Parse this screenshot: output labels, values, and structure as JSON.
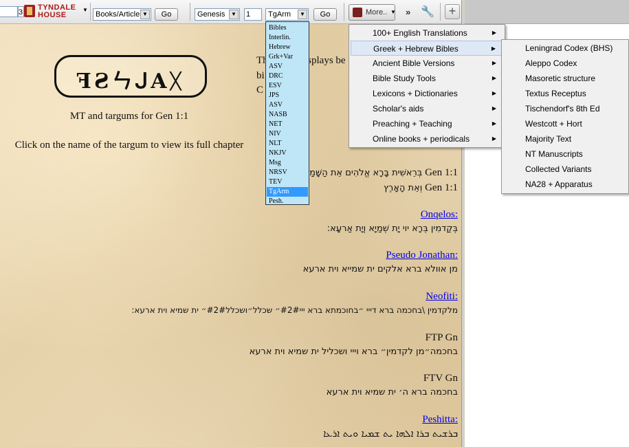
{
  "toolbar": {
    "search_value": "",
    "small_field_value": "3",
    "logo_line1": "TYNDALE",
    "logo_line2": "HOUSE",
    "books_select": "Books/Articles",
    "go1": "Go",
    "book_select": "Genesis",
    "chapter_value": "1",
    "version_select": "TgArm",
    "go2": "Go",
    "more_label": "More..",
    "chevron": "»",
    "plus": "+"
  },
  "versions_list": [
    "Bibles",
    "Interlin.",
    "Hebrew",
    "Grk+Var",
    "ASV",
    "DRC",
    "ESV",
    "JPS",
    "ASV",
    "NASB",
    "NET",
    "NIV",
    "NLT",
    "NKJV",
    "Msg",
    "NRSV",
    "TEV",
    "TgArm",
    "Pesh."
  ],
  "versions_selected_index": 17,
  "menu": {
    "items": [
      {
        "label": "100+ English Translations"
      },
      {
        "label": "Greek + Hebrew Bibles"
      },
      {
        "label": "Ancient Bible Versions"
      },
      {
        "label": "Bible Study Tools"
      },
      {
        "label": "Lexicons + Dictionaries"
      },
      {
        "label": "Scholar's aids"
      },
      {
        "label": "Preaching + Teaching"
      },
      {
        "label": "Online books + periodicals"
      }
    ],
    "highlighted_index": 1,
    "submenu": [
      "Leningrad Codex (BHS)",
      "Aleppo Codex",
      "Masoretic structure",
      "Textus Receptus",
      "Tischendorf's 8th Ed",
      "Westcott + Hort",
      "Majority Text",
      "NT Manuscripts",
      "Collected Variants",
      "NA28 + Apparatus"
    ]
  },
  "content": {
    "cartouche_text": "ꟻƧㄣᒍAᚷ",
    "caption": "MT and targums for Gen 1:1",
    "instruction": "Click on the name of the targum to view its full chapter",
    "intro_line1": "This page displays be",
    "intro_line2": "bi               such as",
    "intro_line3": "C               loaded int",
    "mt_ref": "Gen 1:1",
    "mt_line1": "בְּרֵאשִׁית בָּרָא אֱלֹהִים אֵת הַשָּׁמַ",
    "mt_line2": "וְאֵת הָאָרֶץ",
    "onqelos_title": "Onqelos:",
    "onqelos_text": "בְּקַדמִין בְּרָא יוי יָת שְׁמַיָא וְיָת אַרעָא:",
    "pj_title": "Pseudo Jonathan:",
    "pj_text": "מן אוולא ברא אלקים ית שמייא וית ארעא",
    "neofiti_title": "Neofiti:",
    "neofiti_text": "מלקדמין \\בחכמה ברא דייי ״בחוכמתא ברא ייי#2#״ שכלל״ושכלל#2#״ ית שמיא וית ארעא:",
    "ftp_title": "FTP Gn",
    "ftp_text": "בחכמה״מן לקדמין״ ברא וייי ושכליל ית שמיא וית ארעא",
    "ftv_title": "FTV Gn",
    "ftv_text": "בחכמה ברא ה׳ ית שמיא וית ארעא",
    "peshitta_title": "Peshitta:",
    "peshitta_text": "ܒܪܫܝܬ ܒܪܐ ܐܠܗܐ ܝܬ ܫܡܝܐ ܘܝܬ ܐܪܥܐ"
  }
}
